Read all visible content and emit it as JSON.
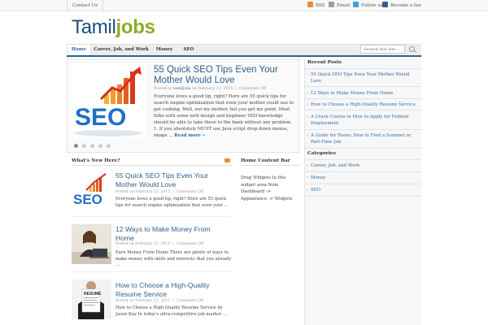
{
  "topbar": {
    "contact": "Contact Us",
    "links": [
      {
        "label": "RSS",
        "icon": "rss-icon",
        "color": "#e8912b"
      },
      {
        "label": "Email",
        "icon": "email-icon",
        "color": "#9aa0a6"
      },
      {
        "label": "Follow us",
        "icon": "twitter-icon",
        "color": "#3aa3d8"
      },
      {
        "label": "Become a fan",
        "icon": "facebook-icon",
        "color": "#3b5998"
      }
    ]
  },
  "logo": {
    "part1": "Tamil",
    "part2": "jobs"
  },
  "nav": {
    "items": [
      {
        "label": "Home"
      },
      {
        "label": "Career, Job, and Work"
      },
      {
        "label": "Money"
      },
      {
        "label": "SEO"
      }
    ],
    "search_placeholder": "Search this site..."
  },
  "featured": {
    "title": "55 Quick SEO Tips Even Your Mother Would Love",
    "meta_posted": "Posted by",
    "meta_author": "tamiljobs",
    "meta_on": "on February 22, 2015",
    "meta_comments": "Comments Off",
    "excerpt": "Everyone loves a good tip, right? Here are 55 quick tips for search engine optimization that even your mother could use to get cooking. Well, not my mother, but you get my point. Most folks with some web design and beginner SEO knowledge should be able to take these to the bank without any problem. 1. If you absolutely MUST use Java script drop down menus, image ...",
    "read_more": "Read more »",
    "slide_count": 5,
    "active_slide": 0,
    "image_text": "SEO"
  },
  "whats_new": {
    "heading": "What's New Here?",
    "posts": [
      {
        "title": "55 Quick SEO Tips Even Your Mother Would Love",
        "meta": "Posted on February 22, 2015",
        "comments": "Comments Off",
        "excerpt": "Everyone loves a good tip, right? Here are 55 quick tips for search engine optimization that even your ...",
        "thumb": "seo-thumb"
      },
      {
        "title": "12 Ways to Make Money From Home",
        "meta": "Posted on February 22, 2015",
        "comments": "Comments Off",
        "excerpt": "Earn Money From Home There are plenty of ways to make money with skills and interests that you already ...",
        "thumb": "woman-laptop-thumb"
      },
      {
        "title": "How to Choose a High-Quality Resume Service",
        "meta": "Posted on February 22, 2015",
        "comments": "Comments Off",
        "excerpt": "How to Choose a High-Quality Resume Service by Jason Kay In today's ultra-competitive job market ...",
        "thumb": "resume-thumb",
        "thumb_text": "RESUME"
      }
    ]
  },
  "home_content_bar": {
    "heading": "Home Content Bar",
    "text": "Drag Widgets to this widget area from Dashboard -> Appearance -> Widgets"
  },
  "sidebar": {
    "recent_heading": "Recent Posts",
    "recent": [
      "55 Quick SEO Tips Even Your Mother Would Love",
      "12 Ways to Make Money From Home",
      "How to Choose a High-Quality Resume Service",
      "A Crash Course in How to Apply for Federal Employment",
      "A Guide for Teens: How to Find a Summer or Part-Time Job"
    ],
    "categories_heading": "Categories",
    "categories": [
      "Career, Job, and Work",
      "Money",
      "SEO"
    ]
  }
}
